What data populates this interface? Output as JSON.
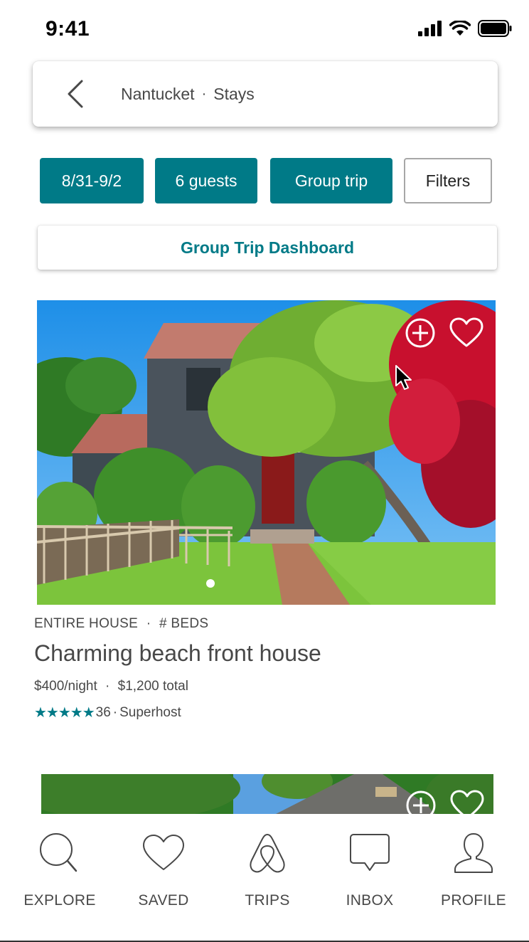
{
  "status_bar": {
    "time": "9:41"
  },
  "header": {
    "location": "Nantucket",
    "separator": "·",
    "category": "Stays"
  },
  "filters": [
    {
      "label": "8/31-9/2",
      "active": true
    },
    {
      "label": "6 guests",
      "active": true
    },
    {
      "label": "Group trip",
      "active": true
    },
    {
      "label": "Filters",
      "active": false
    }
  ],
  "dashboard_button": {
    "label": "Group Trip Dashboard"
  },
  "listing": {
    "type": "ENTIRE HOUSE",
    "beds": "# BEDS",
    "meta_separator": "·",
    "title": "Charming beach front house",
    "price_night": "$400/night",
    "price_separator": "·",
    "price_total": "$1,200 total",
    "stars": "★★★★★",
    "rating_count": "36",
    "rating_separator": "·",
    "host_badge": "Superhost",
    "icons": [
      "add-circle-icon",
      "heart-icon"
    ]
  },
  "nav": [
    {
      "label": "EXPLORE",
      "icon": "search-icon"
    },
    {
      "label": "SAVED",
      "icon": "heart-icon"
    },
    {
      "label": "TRIPS",
      "icon": "airbnb-logo-icon"
    },
    {
      "label": "INBOX",
      "icon": "chat-bubble-icon"
    },
    {
      "label": "PROFILE",
      "icon": "person-icon"
    }
  ],
  "colors": {
    "accent": "#007a87",
    "text": "#484848"
  }
}
